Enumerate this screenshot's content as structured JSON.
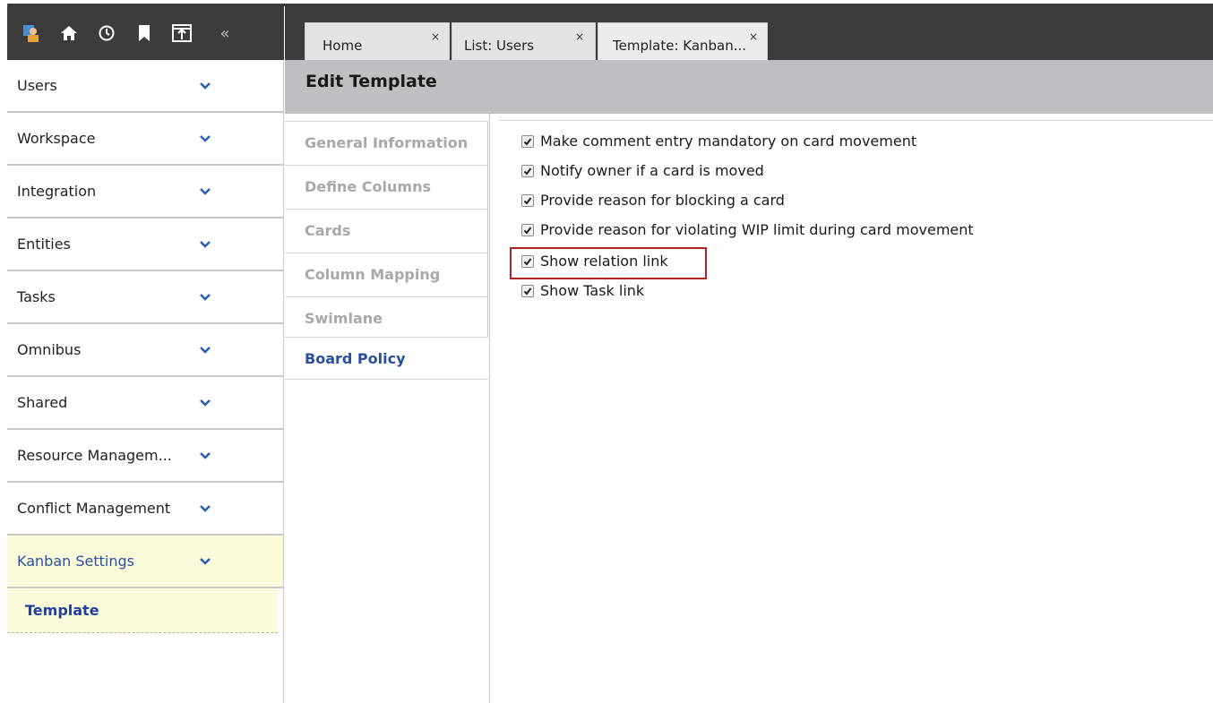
{
  "toolbar": {
    "icons": [
      "user-admin-icon",
      "home-icon",
      "history-icon",
      "bookmark-icon",
      "export-icon",
      "collapse-icon"
    ],
    "collapse_glyph": "«"
  },
  "tabs": [
    {
      "label": "Home",
      "close": "×"
    },
    {
      "label": "List: Users",
      "close": "×"
    },
    {
      "label": "Template: Kanban...",
      "close": "×"
    }
  ],
  "sidebar": {
    "items": [
      {
        "label": "Users"
      },
      {
        "label": "Workspace"
      },
      {
        "label": "Integration"
      },
      {
        "label": "Entities"
      },
      {
        "label": "Tasks"
      },
      {
        "label": "Omnibus"
      },
      {
        "label": "Shared"
      },
      {
        "label": "Resource Managem..."
      },
      {
        "label": "Conflict Management"
      },
      {
        "label": "Kanban Settings"
      }
    ],
    "sub_item": "Template"
  },
  "header": {
    "title": "Edit Template"
  },
  "subtabs": [
    {
      "label": "General Information"
    },
    {
      "label": "Define Columns"
    },
    {
      "label": "Cards"
    },
    {
      "label": "Column Mapping"
    },
    {
      "label": "Swimlane"
    },
    {
      "label": "Board Policy"
    }
  ],
  "options": [
    {
      "label": "Make comment entry mandatory on card movement",
      "checked": true
    },
    {
      "label": "Notify owner if a card is moved",
      "checked": true
    },
    {
      "label": "Provide reason for blocking a card",
      "checked": true
    },
    {
      "label": "Provide reason for violating WIP limit during card movement",
      "checked": true
    },
    {
      "label": "Show relation link",
      "checked": true
    },
    {
      "label": "Show Task link",
      "checked": true
    }
  ],
  "colors": {
    "toolbar_bg": "#3c3c3c",
    "header_bg": "#bdbfc2",
    "active_nav_bg": "#fbfbdb",
    "active_text": "#2a4fa0",
    "highlight": "#b22222"
  }
}
